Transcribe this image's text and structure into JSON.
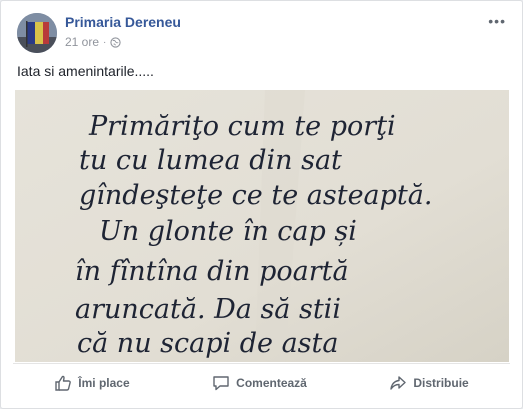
{
  "post": {
    "page_name": "Primaria Dereneu",
    "time": "21 ore",
    "privacy_icon": "globe-icon",
    "text": "Iata si amenintarile....."
  },
  "note": {
    "lines": [
      "Primăriţo cum te porţi",
      "tu cu lumea din sat",
      "gîndeşteţe ce te asteaptă.",
      "Un glonte în cap și",
      "în fîntîna din poartă",
      "aruncată. Da să stii",
      "că nu scapi de asta"
    ]
  },
  "actions": {
    "like_label": "Îmi place",
    "comment_label": "Comentează",
    "share_label": "Distribuie"
  },
  "colors": {
    "link": "#365899",
    "muted": "#90949c",
    "action": "#606770"
  }
}
